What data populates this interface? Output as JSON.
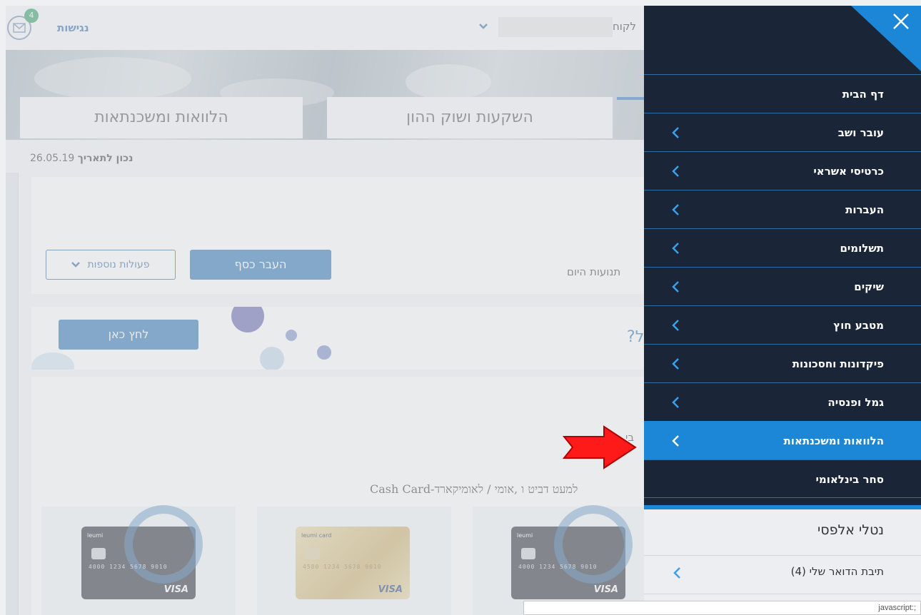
{
  "header": {
    "accessibility_label": "נגישות",
    "mail_badge_count": "4",
    "client_label": "לקוח"
  },
  "tabs": [
    {
      "label": "הלוואות ומשכנתאות"
    },
    {
      "label": "השקעות ושוק ההון"
    }
  ],
  "main": {
    "date_label": "נכון לתאריך",
    "date_value": "26.05.19",
    "more_actions_label": "פעולות נוספות",
    "transfer_label": "העבר כסף",
    "today_label": "תנועות היום",
    "click_here_label": "לחץ כאן",
    "promo_fragment": "?ל",
    "cards_fragment": "בי",
    "cards_title": "Cash Card-למעט דביט ו ,אומי / לאומיקארד"
  },
  "credit_cards": [
    {
      "brand": "leumi",
      "number": "4000 1234 5678 9010",
      "network": "VISA",
      "style": "dark"
    },
    {
      "brand": "leumi card",
      "number": "4580 1234 5678 9010",
      "network": "VISA",
      "style": "gold"
    },
    {
      "brand": "leumi",
      "number": "4000 1234 5678 9010",
      "network": "VISA",
      "style": "dark"
    }
  ],
  "menu": {
    "close_icon": "close-icon",
    "items": [
      {
        "label": "דף הבית",
        "has_submenu": false,
        "active": false
      },
      {
        "label": "עובר ושב",
        "has_submenu": true,
        "active": false
      },
      {
        "label": "כרטיסי אשראי",
        "has_submenu": true,
        "active": false
      },
      {
        "label": "העברות",
        "has_submenu": true,
        "active": false
      },
      {
        "label": "תשלומים",
        "has_submenu": true,
        "active": false
      },
      {
        "label": "שיקים",
        "has_submenu": true,
        "active": false
      },
      {
        "label": "מטבע חוץ",
        "has_submenu": true,
        "active": false
      },
      {
        "label": "פיקדונות וחסכונות",
        "has_submenu": true,
        "active": false
      },
      {
        "label": "גמל ופנסיה",
        "has_submenu": true,
        "active": false
      },
      {
        "label": "הלוואות ומשכנתאות",
        "has_submenu": true,
        "active": true
      },
      {
        "label": "סחר בינלאומי",
        "has_submenu": false,
        "active": false
      }
    ],
    "user_name": "נטלי אלפסי",
    "mailbox_label": "תיבת הדואר שלי (4)"
  },
  "status_bar": {
    "text": "javascript:;"
  },
  "colors": {
    "menu_bg": "#1a2637",
    "menu_active": "#1c87d6",
    "menu_divider": "#2c6fa6",
    "primary_button": "#1f6cb0",
    "annotation_arrow": "#ff1a1a"
  }
}
